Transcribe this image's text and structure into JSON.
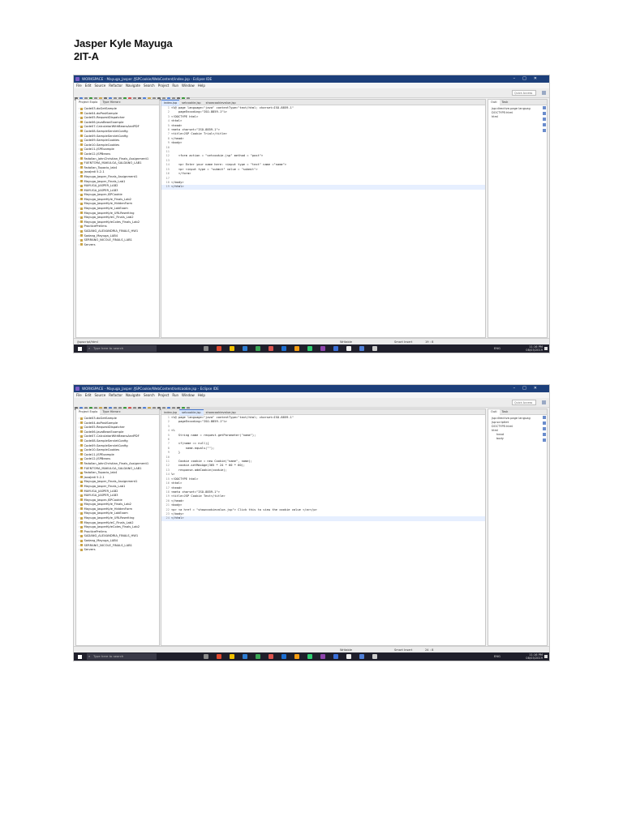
{
  "header": {
    "name": "Jasper Kyle Mayuga",
    "section": "2IT-A"
  },
  "screenshots": [
    {
      "title": "WORKSPACE - Mayuga_Jasper /JSPCookie/WebContent/index.jsp - Eclipse IDE",
      "menu": [
        "File",
        "Edit",
        "Source",
        "Refactor",
        "Navigate",
        "Search",
        "Project",
        "Run",
        "Window",
        "Help"
      ],
      "quick_access": "Quick Access",
      "explorer_tabs": [
        "Project Explo",
        "Type Hierarc"
      ],
      "editor_tabs": [
        "index.jsp",
        "setcookie.jsp",
        "showcookievalue.jsp"
      ],
      "outline_tabs": [
        "Outl",
        "Task"
      ],
      "projects": [
        "Code03-doGetSample",
        "Code04-doPostSample",
        "Code05-RequestDispatcher",
        "Code06-JavaBeanExample",
        "Code07-CalculatorWithBeansAndPDF",
        "Code08-SampleServletConfig",
        "Code09-SampleServletConfig",
        "Code09-SampleCookies",
        "Code10-SampleCookies",
        "Code11-JSPExample",
        "Code12-JSPBeans",
        "Fadollan_JohnChristian_Finals_Assignment1",
        "FUENTORA_MAKULGA_SALDANO_LAB1",
        "Fadollan_Topacio_lab4",
        "JavaJedi 5.2-1",
        "Mayuga_Jasper_Finals_Assignment1",
        "Mayuga_Jasper_Finals_Lab1",
        "MAYUGA_JASPER_LAB2",
        "MAYUGA_JASPER_LAB3",
        "Mayuga_Jasper-JSPCookie",
        "Mayuga_JasperKyle_Finals_Lab2",
        "Mayuga_JasperKyle_HiddenForm",
        "Mayuga_JasperKyle_LabExam",
        "Mayuga_JasperKyle_URLRewriting",
        "Mayuga_JasperKyleC_Finals_Lab2",
        "Mayuga_JasperKyleColes_Finals_Lab2",
        "PracticePrelims",
        "SADANG_ALEXANDRIA_FINALS_HW1",
        "Sadang_Mayuga_LAB4",
        "SERRANO_NICOLE_FINALS_LAB1",
        "Servers"
      ],
      "code": [
        {
          "n": "1",
          "t": "<%@ page language=\"java\" contentType=\"text/html; charset=ISO-8859-1\""
        },
        {
          "n": "2",
          "t": "    pageEncoding=\"ISO-8859-1\"%>"
        },
        {
          "n": "3",
          "t": "<!DOCTYPE html>"
        },
        {
          "n": "4",
          "t": "<html>"
        },
        {
          "n": "5",
          "t": "<head>"
        },
        {
          "n": "6",
          "t": "<meta charset=\"ISO-8859-1\">"
        },
        {
          "n": "7",
          "t": "<title>JSP Cookie Trial</title>"
        },
        {
          "n": "8",
          "t": "</head>"
        },
        {
          "n": "9",
          "t": "<body>"
        },
        {
          "n": "10",
          "t": ""
        },
        {
          "n": "11",
          "t": ""
        },
        {
          "n": "12",
          "t": "    <form action = \"setcookie.jsp\" method = \"post\">"
        },
        {
          "n": "13",
          "t": ""
        },
        {
          "n": "14",
          "t": "    <p> Enter your name here: <input type = \"text\" name =\"name\">"
        },
        {
          "n": "15",
          "t": "    <p> <input type = \"submit\" value = \"submit\">"
        },
        {
          "n": "16",
          "t": "    </form>"
        },
        {
          "n": "17",
          "t": ""
        },
        {
          "n": "18",
          "t": "</body>"
        },
        {
          "n": "19",
          "t": "</html>"
        }
      ],
      "outline": [
        {
          "t": "jsp:directive.page languag",
          "sub": false
        },
        {
          "t": "DOCTYPE:html",
          "sub": false
        },
        {
          "t": "html",
          "sub": false
        }
      ],
      "status": {
        "left": "/jspscript/html",
        "writable": "Writable",
        "insert": "Smart Insert",
        "pos": "19 : 8"
      },
      "taskbar": {
        "search": "Type here to search",
        "lang": "ENG",
        "time": "11:16 PM",
        "date": "08/03/2019"
      }
    },
    {
      "title": "WORKSPACE - Mayuga_Jasper /JSPCookie/WebContent/setcookie.jsp - Eclipse IDE",
      "menu": [
        "File",
        "Edit",
        "Source",
        "Refactor",
        "Navigate",
        "Search",
        "Project",
        "Run",
        "Window",
        "Help"
      ],
      "quick_access": "Quick Access",
      "explorer_tabs": [
        "Project Explo",
        "Type Hierarc"
      ],
      "editor_tabs": [
        "index.jsp",
        "setcookie.jsp",
        "showcookievalue.jsp"
      ],
      "outline_tabs": [
        "Outl",
        "Task"
      ],
      "projects": [
        "Code03-doGetSample",
        "Code04-doPostSample",
        "Code05-RequestDispatcher",
        "Code06-JavaBeanExample",
        "Code07-CalculatorWithBeansAndPDF",
        "Code08-SampleServletConfig",
        "Code09-SampleServletConfig",
        "Code10-SampleCookies",
        "Code11-JSPExample",
        "Code12-JSPBeans",
        "Fadollan_JohnChristian_Finals_Assignment1",
        "FUENTORA_MAKULGA_SALDANO_LAB1",
        "Fadollan_Topacio_lab4",
        "JavaJedi 5.2-1",
        "Mayuga_Jasper_Finals_Assignment1",
        "Mayuga_Jasper_Finals_Lab1",
        "MAYUGA_JASPER_LAB2",
        "MAYUGA_JASPER_LAB3",
        "Mayuga_Jasper-JSPCookie",
        "Mayuga_JasperKyle_Finals_Lab2",
        "Mayuga_JasperKyle_HiddenForm",
        "Mayuga_JasperKyle_LabExam",
        "Mayuga_JasperKyle_URLRewriting",
        "Mayuga_JasperKyleC_Finals_Lab2",
        "Mayuga_JasperKyleColes_Finals_Lab2",
        "PracticePrelims",
        "SADANG_ALEXANDRIA_FINALS_HW1",
        "Sadang_Mayuga_LAB4",
        "SERRANO_NICOLE_FINALS_LAB1",
        "Servers"
      ],
      "code": [
        {
          "n": "1",
          "t": "<%@ page language=\"java\" contentType=\"text/html; charset=ISO-8859-1\""
        },
        {
          "n": "2",
          "t": "    pageEncoding=\"ISO-8859-1\"%>"
        },
        {
          "n": "3",
          "t": ""
        },
        {
          "n": "4",
          "t": "<%"
        },
        {
          "n": "5",
          "t": "    String name = request.getParameter(\"name\");"
        },
        {
          "n": "6",
          "t": ""
        },
        {
          "n": "7",
          "t": "    if(name == null){"
        },
        {
          "n": "8",
          "t": "        name.equals(\"\");"
        },
        {
          "n": "9",
          "t": "    }"
        },
        {
          "n": "10",
          "t": ""
        },
        {
          "n": "11",
          "t": "    Cookie cookie = new Cookie(\"name\", name);"
        },
        {
          "n": "12",
          "t": "    cookie.setMaxAge(365 * 24 * 60 * 60);"
        },
        {
          "n": "13",
          "t": "    response.addCookie(cookie);"
        },
        {
          "n": "14",
          "t": "%>"
        },
        {
          "n": "15",
          "t": "<!DOCTYPE html>"
        },
        {
          "n": "16",
          "t": "<html>"
        },
        {
          "n": "17",
          "t": "<head>"
        },
        {
          "n": "18",
          "t": "<meta charset=\"ISO-8859-1\">"
        },
        {
          "n": "19",
          "t": "<title>JSP Cookie Test</title>"
        },
        {
          "n": "20",
          "t": "</head>"
        },
        {
          "n": "21",
          "t": "<body>"
        },
        {
          "n": "22",
          "t": "<p> <a href = \"showcookievalue.jsp\"> Click this to view the cookie value </a></p>"
        },
        {
          "n": "23",
          "t": "</body>"
        },
        {
          "n": "24",
          "t": "</html>"
        }
      ],
      "outline": [
        {
          "t": "jsp:directive.page languag",
          "sub": false
        },
        {
          "t": "jsp:scriptlet",
          "sub": false
        },
        {
          "t": "DOCTYPE:html",
          "sub": false
        },
        {
          "t": "html",
          "sub": false
        },
        {
          "t": "head",
          "sub": true
        },
        {
          "t": "body",
          "sub": true
        }
      ],
      "status": {
        "left": "",
        "writable": "Writable",
        "insert": "Smart Insert",
        "pos": "24 : 8"
      },
      "taskbar": {
        "search": "Type here to search",
        "lang": "ENG",
        "time": "11:16 PM",
        "date": "08/03/2019"
      }
    }
  ]
}
